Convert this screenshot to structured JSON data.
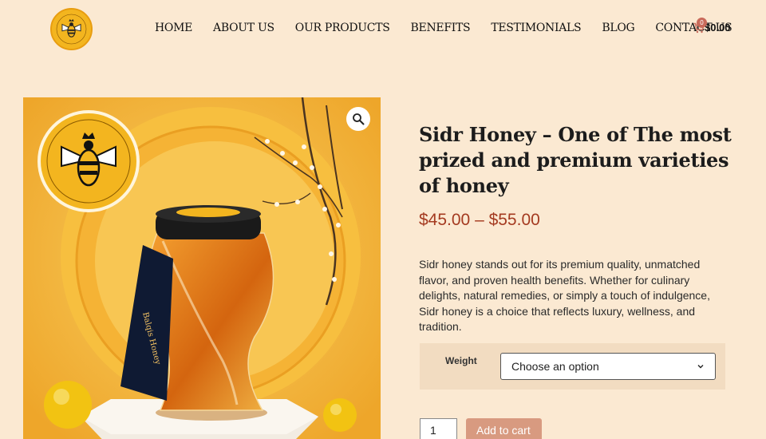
{
  "nav": {
    "items": [
      {
        "label": "HOME"
      },
      {
        "label": "ABOUT US"
      },
      {
        "label": "OUR PRODUCTS"
      },
      {
        "label": "BENEFITS"
      },
      {
        "label": "TESTIMONIALS"
      },
      {
        "label": "BLOG"
      },
      {
        "label": "CONTACT US"
      }
    ]
  },
  "cart": {
    "count": "0",
    "total": "$0.00",
    "icon": "cart-icon"
  },
  "product": {
    "title": "Sidr Honey – One of The most prized and premium varieties of honey",
    "price": "$45.00 – $55.00",
    "description": "Sidr honey stands out for its premium quality, unmatched flavor, and proven health benefits. Whether for culinary delights, natural remedies, or simply a touch of indulgence, Sidr honey is a choice that reflects luxury, wellness, and tradition.",
    "variation_label": "Weight",
    "select_value": "Choose an option",
    "quantity": "1",
    "add_to_cart_label": "Add to cart"
  },
  "colors": {
    "background": "#fbe9d2",
    "price": "#a43a20",
    "button": "#d89a80",
    "variation_bg": "#f2dcc1"
  }
}
